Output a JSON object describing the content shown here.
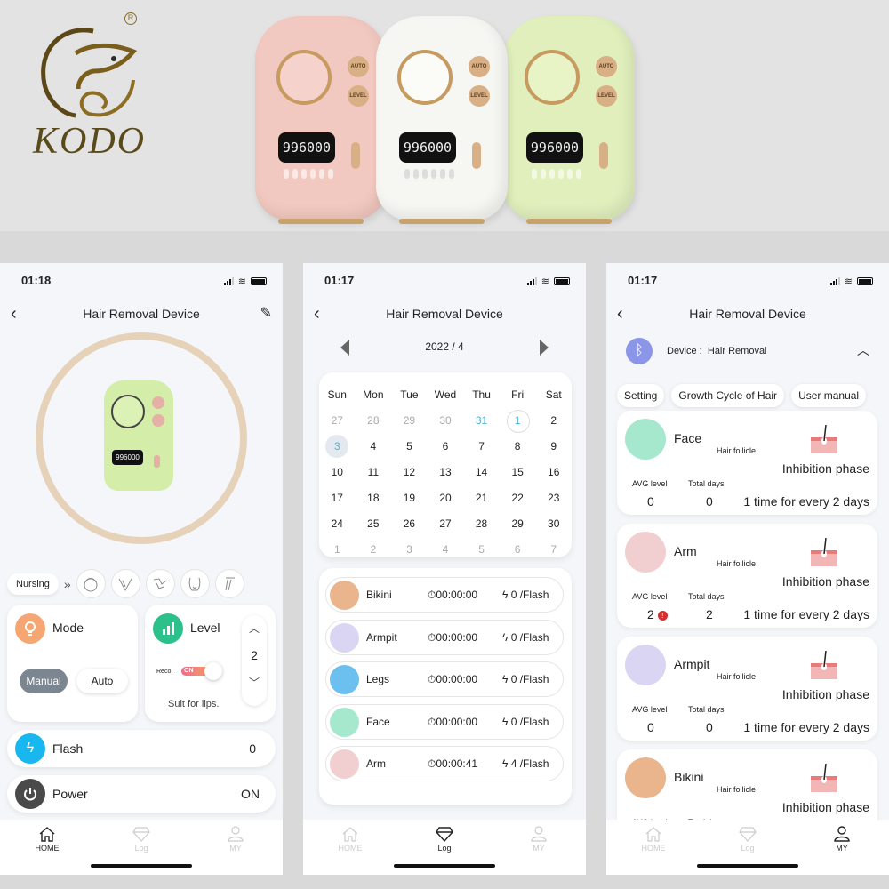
{
  "brand": {
    "name": "KODO",
    "registered": "R"
  },
  "product_colors": [
    "#f2c9c0",
    "#f6f6f3",
    "#e1efbd"
  ],
  "product_display": {
    "counter": "996000",
    "buttons": [
      "AUTO",
      "LEVEL"
    ]
  },
  "screens": {
    "home": {
      "status_time": "01:18",
      "title": "Hair Removal Device",
      "device_counter": "996000",
      "nursing_label": "Nursing",
      "chevrons": "»",
      "body_areas": [
        "face",
        "arm",
        "armpit",
        "bikini",
        "legs"
      ],
      "mode": {
        "label": "Mode",
        "options": [
          "Manual",
          "Auto"
        ],
        "selected": "Manual"
      },
      "level": {
        "label": "Level",
        "value": "2",
        "reco_label": "Reco.",
        "toggle_state": "ON",
        "hint": "Suit for lips."
      },
      "flash": {
        "label": "Flash",
        "value": "0"
      },
      "power": {
        "label": "Power",
        "value": "ON"
      },
      "active_tab": "HOME"
    },
    "log": {
      "status_time": "01:17",
      "title": "Hair Removal Device",
      "month": "2022 / 4",
      "weekdays": [
        "Sun",
        "Mon",
        "Tue",
        "Wed",
        "Thu",
        "Fri",
        "Sat"
      ],
      "days": [
        [
          "27",
          "28",
          "29",
          "30",
          "31",
          "1",
          "2"
        ],
        [
          "3",
          "4",
          "5",
          "6",
          "7",
          "8",
          "9"
        ],
        [
          "10",
          "11",
          "12",
          "13",
          "14",
          "15",
          "16"
        ],
        [
          "17",
          "18",
          "19",
          "20",
          "21",
          "22",
          "23"
        ],
        [
          "24",
          "25",
          "26",
          "27",
          "28",
          "29",
          "30"
        ],
        [
          "1",
          "2",
          "3",
          "4",
          "5",
          "6",
          "7"
        ]
      ],
      "today": "1",
      "selected_day": "3",
      "entries": [
        {
          "area": "Bikini",
          "time": "00:00:00",
          "flash": "0 /Flash",
          "color": "#eab48d"
        },
        {
          "area": "Armpit",
          "time": "00:00:00",
          "flash": "0 /Flash",
          "color": "#d9d5f3"
        },
        {
          "area": "Legs",
          "time": "00:00:00",
          "flash": "0 /Flash",
          "color": "#6cc0ef"
        },
        {
          "area": "Face",
          "time": "00:00:00",
          "flash": "0 /Flash",
          "color": "#a6e8cd"
        },
        {
          "area": "Arm",
          "time": "00:00:41",
          "flash": "4 /Flash",
          "color": "#f1cfd0"
        }
      ],
      "active_tab": "Log"
    },
    "my": {
      "status_time": "01:17",
      "title": "Hair Removal Device",
      "device_label": "Device :",
      "device_name": "Hair Removal",
      "chips": [
        "Setting",
        "Growth Cycle of Hair",
        "User manual"
      ],
      "follicle_label": "Hair follicle",
      "avg_label": "AVG level",
      "days_label": "Total days",
      "areas": [
        {
          "name": "Face",
          "phase": "Inhibition phase",
          "avg": "0",
          "days": "0",
          "frequency": "1 time for every 2 days",
          "color": "#a6e8cd",
          "warning": false
        },
        {
          "name": "Arm",
          "phase": "Inhibition phase",
          "avg": "2",
          "days": "2",
          "frequency": "1 time for every 2 days",
          "color": "#f1cfd0",
          "warning": true
        },
        {
          "name": "Armpit",
          "phase": "Inhibition phase",
          "avg": "0",
          "days": "0",
          "frequency": "1 time for every 2 days",
          "color": "#d9d5f3",
          "warning": false
        },
        {
          "name": "Bikini",
          "phase": "Inhibition phase",
          "avg": "",
          "days": "",
          "frequency": "",
          "color": "#eab48d",
          "warning": false
        }
      ],
      "active_tab": "MY"
    }
  },
  "tabs": [
    "HOME",
    "Log",
    "MY"
  ]
}
